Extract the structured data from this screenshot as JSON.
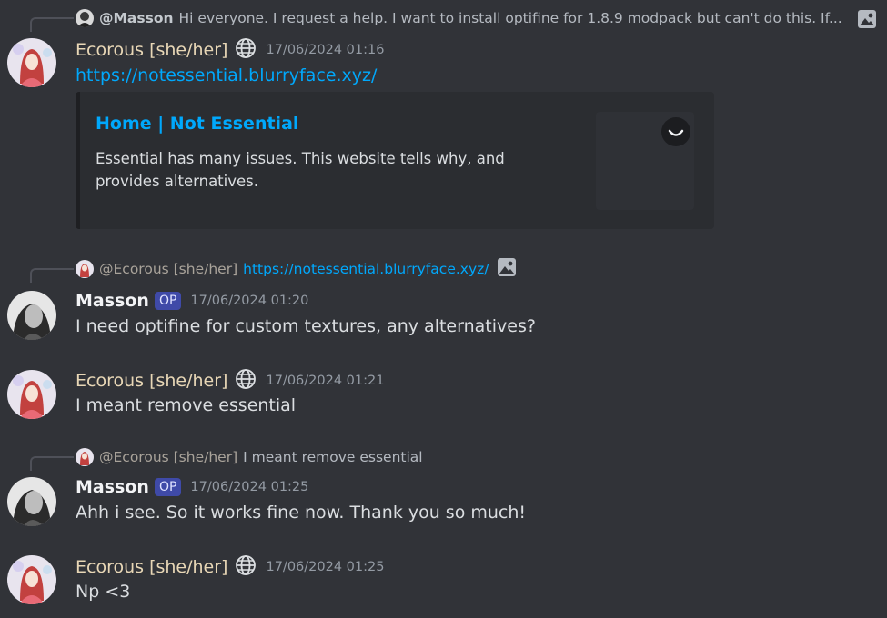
{
  "messages": [
    {
      "reply": {
        "author": "@Masson",
        "text": "Hi everyone. I request a help. I want to install optifine for 1.8.9 modpack but can't do this.  If..."
      },
      "author": "Ecorous [she/her]",
      "timestamp": "17/06/2024 01:16",
      "content": "https://notessential.blurryface.xyz/",
      "embed": {
        "title": "Home | Not Essential",
        "description": "Essential has many issues. This website tells why, and provides alternatives."
      }
    },
    {
      "reply": {
        "author": "@Ecorous [she/her]",
        "text": "https://notessential.blurryface.xyz/"
      },
      "author": "Masson",
      "badge": "OP",
      "timestamp": "17/06/2024 01:20",
      "content": "I need optifine for custom textures, any alternatives?"
    },
    {
      "author": "Ecorous [she/her]",
      "timestamp": "17/06/2024 01:21",
      "content": "I meant remove essential"
    },
    {
      "reply": {
        "author": "@Ecorous [she/her]",
        "text": "I meant remove essential"
      },
      "author": "Masson",
      "badge": "OP",
      "timestamp": "17/06/2024 01:25",
      "content": "Ahh i see. So it works fine now. Thank you so much!"
    },
    {
      "author": "Ecorous [she/her]",
      "timestamp": "17/06/2024 01:25",
      "content": "Np <3"
    }
  ],
  "colors": {
    "background": "#313338",
    "link": "#00a8fc",
    "embed_bg": "#2b2d31",
    "ecorous_name": "#e8d7b6",
    "op_badge": "#3f4aa8"
  }
}
